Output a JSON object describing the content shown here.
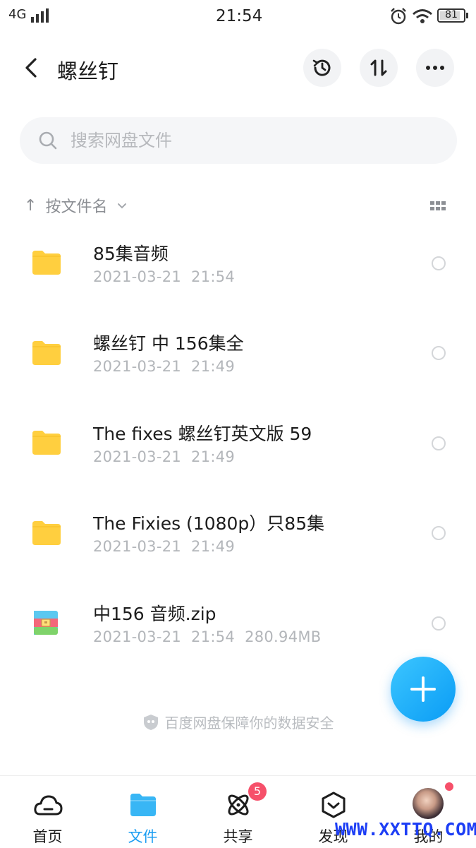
{
  "status_bar": {
    "network": "4G",
    "time": "21:54",
    "battery": "81"
  },
  "header": {
    "back_label": "‹",
    "title": "螺丝钉"
  },
  "search": {
    "placeholder": "搜索网盘文件"
  },
  "sort": {
    "arrow": "↑",
    "label": "按文件名"
  },
  "files": [
    {
      "name": "85集音频",
      "date": "2021-03-21",
      "time": "21:54",
      "size": "",
      "type": "folder"
    },
    {
      "name": "螺丝钉 中 156集全",
      "date": "2021-03-21",
      "time": "21:49",
      "size": "",
      "type": "folder"
    },
    {
      "name": "The fixes 螺丝钉英文版 59",
      "date": "2021-03-21",
      "time": "21:49",
      "size": "",
      "type": "folder"
    },
    {
      "name": "The Fixies (1080p）只85集",
      "date": "2021-03-21",
      "time": "21:49",
      "size": "",
      "type": "folder"
    },
    {
      "name": "中156 音频.zip",
      "date": "2021-03-21",
      "time": "21:54",
      "size": "280.94MB",
      "type": "zip"
    }
  ],
  "safe_note": "百度网盘保障你的数据安全",
  "tabs": [
    {
      "label": "首页",
      "icon": "cloud-icon",
      "active": false
    },
    {
      "label": "文件",
      "icon": "folder-icon",
      "active": true
    },
    {
      "label": "共享",
      "icon": "atom-icon",
      "active": false,
      "badge": "5"
    },
    {
      "label": "发现",
      "icon": "discover-icon",
      "active": false
    },
    {
      "label": "我的",
      "icon": "avatar",
      "active": false
    }
  ],
  "watermark": "WWW.XXTTQ.COM",
  "colors": {
    "accent": "#1a9df2",
    "folder": "#ffcf3f",
    "badge": "#f6506a"
  }
}
